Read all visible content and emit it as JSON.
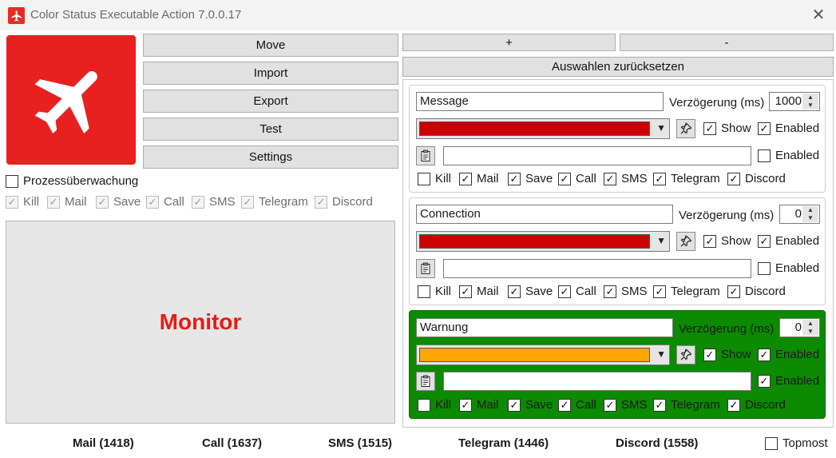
{
  "window": {
    "title": "Color Status Executable Action 7.0.0.17",
    "close_glyph": "✕"
  },
  "left_buttons": {
    "move": "Move",
    "import": "Import",
    "export": "Export",
    "test": "Test",
    "settings": "Settings"
  },
  "top_buttons": {
    "plus": "+",
    "minus": "-",
    "reset": "Auswahlen zurücksetzen"
  },
  "process_monitoring": {
    "label": "Prozessüberwachung",
    "checked": false
  },
  "global_flags": {
    "kill": "Kill",
    "mail": "Mail",
    "save": "Save",
    "call": "Call",
    "sms": "SMS",
    "telegram": "Telegram",
    "discord": "Discord"
  },
  "monitor": {
    "label": "Monitor"
  },
  "stats": {
    "mail": "Mail (1418)",
    "call": "Call (1637)",
    "sms": "SMS (1515)",
    "telegram": "Telegram (1446)",
    "discord": "Discord (1558)"
  },
  "topmost": {
    "label": "Topmost",
    "checked": false
  },
  "rules_labels": {
    "delay": "Verzögerung (ms)",
    "show": "Show",
    "enabled": "Enabled",
    "kill": "Kill",
    "mail": "Mail",
    "save": "Save",
    "call": "Call",
    "sms": "SMS",
    "telegram": "Telegram",
    "discord": "Discord"
  },
  "rules": [
    {
      "name": "Message",
      "delay": "1000",
      "color": "#cc0000",
      "background": "#ffffff",
      "path": ""
    },
    {
      "name": "Connection",
      "delay": "0",
      "color": "#cc0000",
      "background": "#ffffff",
      "path": ""
    },
    {
      "name": "Warnung",
      "delay": "0",
      "color": "#ffa500",
      "background": "#0c8a00",
      "path": ""
    }
  ],
  "colors": {
    "accent_red": "#e8201f",
    "monitor_text": "#e81b16",
    "active_group": "#0c8a00"
  }
}
